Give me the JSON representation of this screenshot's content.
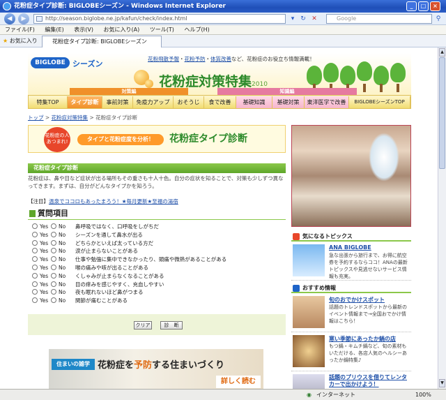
{
  "window": {
    "title": "花粉症タイプ診断: BIGLOBEシーズン - Windows Internet Explorer",
    "address": "http://season.biglobe.ne.jp/kafun/check/index.html",
    "search_placeholder": "Google",
    "menu": [
      "ファイル(F)",
      "編集(E)",
      "表示(V)",
      "お気に入り(A)",
      "ツール(T)",
      "ヘルプ(H)"
    ],
    "favorites_label": "お気に入り",
    "tab_title": "花粉症タイプ診断: BIGLOBEシーズン",
    "status_zone": "インターネット",
    "zoom": "100%"
  },
  "header": {
    "logo": "BIGLOBE",
    "logo_suffix": "シーズン",
    "utility_links": [
      "花粉飛散予報",
      "花粉予防",
      "体質改善"
    ],
    "utility_suffix": "など、花粉症のお役立ち情報満載！",
    "title": "花粉症対策特集",
    "year": "2010",
    "category_left": "対策編",
    "category_right": "知識編"
  },
  "nav": [
    "特集TOP",
    "タイプ診断",
    "事前対策",
    "免疫力アップ",
    "おそうじ",
    "食で改善",
    "基礎知識",
    "基礎対策",
    "東洋医学で改善",
    "BIGLOBEシーズンTOP"
  ],
  "breadcrumb": {
    "items": [
      "トップ",
      "花粉症対策特集"
    ],
    "current": "花粉症タイプ診断"
  },
  "banner": {
    "badge": "花粉症の人あつまれ!",
    "pill": "タイプと花粉症度を分析！",
    "title": "花粉症タイプ診断"
  },
  "section": {
    "title": "花粉症タイプ診断",
    "intro": "花粉症は、鼻や目など症状が出る場所もその重さも十人十色。自分の症状を知ることで、対策も少しずつ異なってきます。まずは、自分がどんなタイプかを知ろう。"
  },
  "note": {
    "prefix": "【注目】",
    "link": "温泉でココロもあったまろう！★毎月更新★至福の湯宿"
  },
  "questions": {
    "heading": "質問項目",
    "yes": "Yes",
    "no": "No",
    "items": [
      "鼻呼吸ではなく、口呼吸をしがちだ",
      "シーズンを通して鼻水が出る",
      "どちらかといえば太っている方だ",
      "涙が止まらないことがある",
      "仕事や勉強に集中できなかったり、頭痛や微熱があることがある",
      "喉の痛みや咳が出ることがある",
      "くしゃみが止まらなくなることがある",
      "目の痒みを感じやすく、充血しやすい",
      "夜も眠れないほど鼻がつまる",
      "関節が痛むことがある"
    ],
    "clear_button": "クリア",
    "diagnose_button": "診　断"
  },
  "ad": {
    "tag": "住まいの雑学",
    "title_pre": "花粉症",
    "title_mid": "を",
    "title_accent": "予防",
    "title_post": "する住まいづくり",
    "more": "詳しく読む"
  },
  "sidebar": {
    "topics_title": "気になるトピックス",
    "topics": [
      {
        "title": "ANA BIGLOBE",
        "desc": "急な出張から旅行まで、お得に航空券を予約するならココ！ANAの最新トピックスや見逃せないサービス情報も充実。"
      }
    ],
    "recommend_title": "おすすめ情報",
    "recommend": [
      {
        "title": "旬のおでかけスポット",
        "desc": "話題のトレンドスポットから最新のイベント情報まで→全国おでかけ情報はこちら！"
      },
      {
        "title": "寒い季節にあったか鍋の店",
        "desc": "もつ鍋・キムチ鍋など、旬の素材もいただける、各店人気のヘルシーあったか鍋特集♪"
      },
      {
        "title": "話題のプリウスを借りてレンタカーで出かけよう！",
        "desc": ""
      }
    ]
  },
  "colors": {
    "accent_green": "#5ea62a",
    "accent_orange": "#f0902a",
    "link_blue": "#1e4fa8"
  }
}
